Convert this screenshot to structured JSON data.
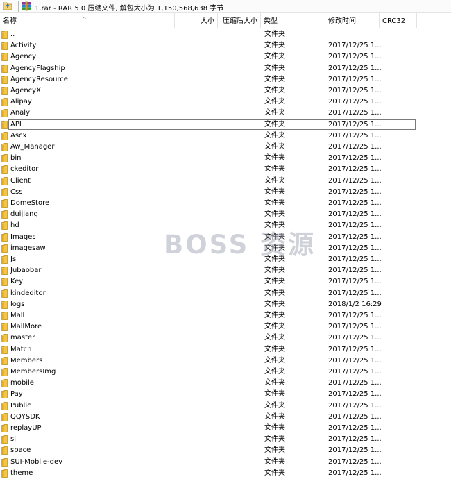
{
  "window": {
    "title": "1.rar - RAR 5.0 压缩文件, 解包大小为 1,150,568,638 字节"
  },
  "icons": {
    "up": "up-folder-arrow-icon",
    "archive": "winrar-archive-icon",
    "folder": "folder-icon"
  },
  "columns": {
    "name": "名称",
    "size": "大小",
    "packed": "压缩后大小",
    "type": "类型",
    "modified": "修改时间",
    "crc": "CRC32"
  },
  "files": [
    {
      "name": "..",
      "type": "文件夹",
      "modified": ""
    },
    {
      "name": "Activity",
      "type": "文件夹",
      "modified": "2017/12/25 1..."
    },
    {
      "name": "Agency",
      "type": "文件夹",
      "modified": "2017/12/25 1..."
    },
    {
      "name": "AgencyFlagship",
      "type": "文件夹",
      "modified": "2017/12/25 1..."
    },
    {
      "name": "AgencyResource",
      "type": "文件夹",
      "modified": "2017/12/25 1..."
    },
    {
      "name": "AgencyX",
      "type": "文件夹",
      "modified": "2017/12/25 1..."
    },
    {
      "name": "Alipay",
      "type": "文件夹",
      "modified": "2017/12/25 1..."
    },
    {
      "name": "Analy",
      "type": "文件夹",
      "modified": "2017/12/25 1..."
    },
    {
      "name": "API",
      "type": "文件夹",
      "modified": "2017/12/25 1..."
    },
    {
      "name": "Ascx",
      "type": "文件夹",
      "modified": "2017/12/25 1..."
    },
    {
      "name": "Aw_Manager",
      "type": "文件夹",
      "modified": "2017/12/25 1..."
    },
    {
      "name": "bin",
      "type": "文件夹",
      "modified": "2017/12/25 1..."
    },
    {
      "name": "ckeditor",
      "type": "文件夹",
      "modified": "2017/12/25 1..."
    },
    {
      "name": "Client",
      "type": "文件夹",
      "modified": "2017/12/25 1..."
    },
    {
      "name": "Css",
      "type": "文件夹",
      "modified": "2017/12/25 1..."
    },
    {
      "name": "DomeStore",
      "type": "文件夹",
      "modified": "2017/12/25 1..."
    },
    {
      "name": "duijiang",
      "type": "文件夹",
      "modified": "2017/12/25 1..."
    },
    {
      "name": "hd",
      "type": "文件夹",
      "modified": "2017/12/25 1..."
    },
    {
      "name": "Images",
      "type": "文件夹",
      "modified": "2017/12/25 1..."
    },
    {
      "name": "imagesaw",
      "type": "文件夹",
      "modified": "2017/12/25 1..."
    },
    {
      "name": "Js",
      "type": "文件夹",
      "modified": "2017/12/25 1..."
    },
    {
      "name": "Jubaobar",
      "type": "文件夹",
      "modified": "2017/12/25 1..."
    },
    {
      "name": "Key",
      "type": "文件夹",
      "modified": "2017/12/25 1..."
    },
    {
      "name": "kindeditor",
      "type": "文件夹",
      "modified": "2017/12/25 1..."
    },
    {
      "name": "logs",
      "type": "文件夹",
      "modified": "2018/1/2 16:29"
    },
    {
      "name": "Mall",
      "type": "文件夹",
      "modified": "2017/12/25 1..."
    },
    {
      "name": "MallMore",
      "type": "文件夹",
      "modified": "2017/12/25 1..."
    },
    {
      "name": "master",
      "type": "文件夹",
      "modified": "2017/12/25 1..."
    },
    {
      "name": "Match",
      "type": "文件夹",
      "modified": "2017/12/25 1..."
    },
    {
      "name": "Members",
      "type": "文件夹",
      "modified": "2017/12/25 1..."
    },
    {
      "name": "MembersImg",
      "type": "文件夹",
      "modified": "2017/12/25 1..."
    },
    {
      "name": "mobile",
      "type": "文件夹",
      "modified": "2017/12/25 1..."
    },
    {
      "name": "Pay",
      "type": "文件夹",
      "modified": "2017/12/25 1..."
    },
    {
      "name": "Public",
      "type": "文件夹",
      "modified": "2017/12/25 1..."
    },
    {
      "name": "QQYSDK",
      "type": "文件夹",
      "modified": "2017/12/25 1..."
    },
    {
      "name": "replayUP",
      "type": "文件夹",
      "modified": "2017/12/25 1..."
    },
    {
      "name": "sj",
      "type": "文件夹",
      "modified": "2017/12/25 1..."
    },
    {
      "name": "space",
      "type": "文件夹",
      "modified": "2017/12/25 1..."
    },
    {
      "name": "SUI-Mobile-dev",
      "type": "文件夹",
      "modified": "2017/12/25 1..."
    },
    {
      "name": "theme",
      "type": "文件夹",
      "modified": "2017/12/25 1..."
    }
  ],
  "focused_file": "API",
  "watermark": "BOSS 资源"
}
